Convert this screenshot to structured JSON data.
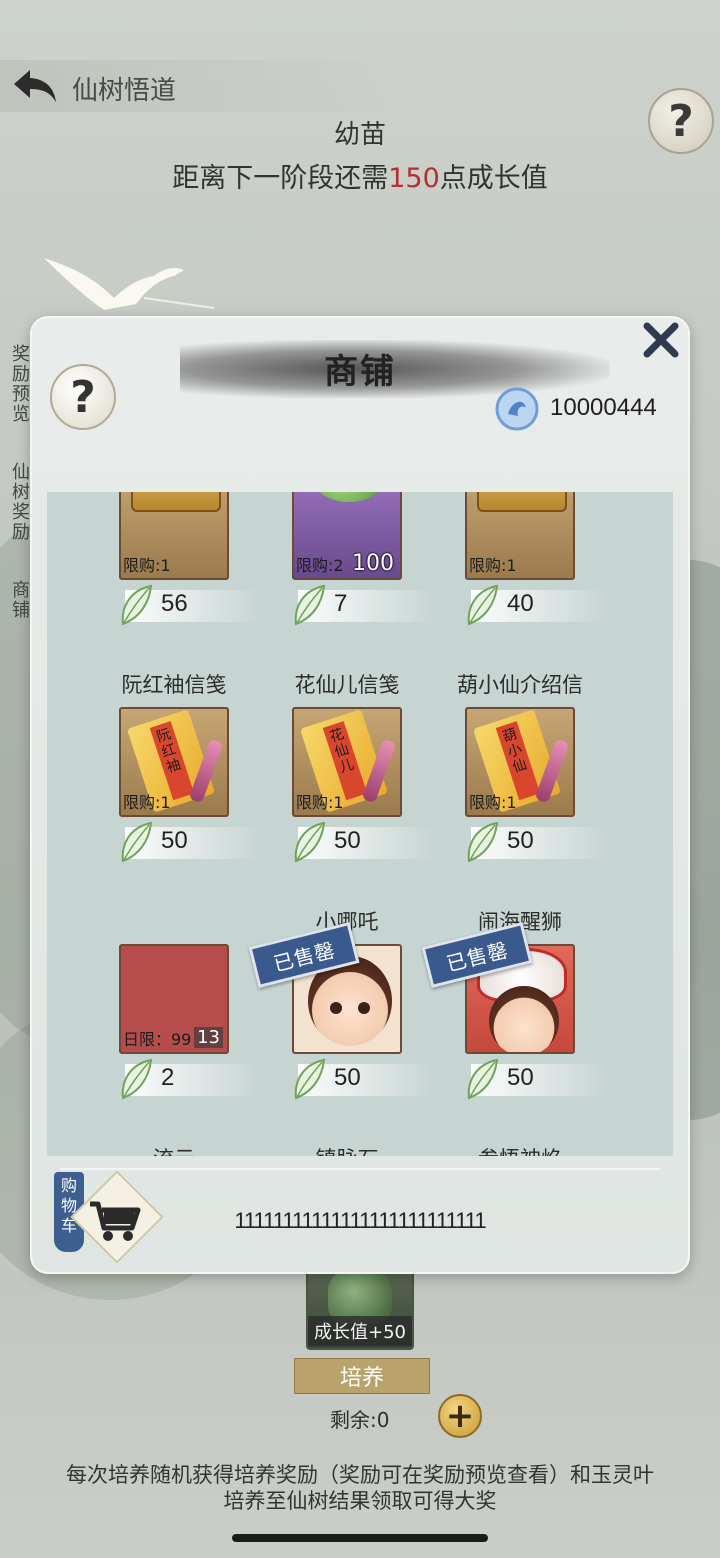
{
  "header": {
    "title": "仙树悟道",
    "stage_name": "幼苗",
    "stage_need_prefix": "距离下一阶段还需",
    "stage_need_value": "150",
    "stage_need_suffix": "点成长值"
  },
  "side_tabs": [
    "奖励预览",
    "仙树奖励",
    "商铺"
  ],
  "shop": {
    "title": "商铺",
    "currency_amount": "10000444",
    "items": [
      {
        "name": "",
        "limit": "限购:1",
        "qty": "",
        "price": "56",
        "art": "chest",
        "sold_out": false
      },
      {
        "name": "",
        "limit": "限购:2",
        "qty": "100",
        "price": "7",
        "art": "jade",
        "sold_out": false
      },
      {
        "name": "",
        "limit": "限购:1",
        "qty": "",
        "price": "40",
        "art": "chest",
        "sold_out": false
      },
      {
        "name": "阮红袖信笺",
        "limit": "限购:1",
        "qty": "",
        "price": "50",
        "art": "letter",
        "letter_text": "阮红袖",
        "sold_out": false
      },
      {
        "name": "花仙儿信笺",
        "limit": "限购:1",
        "qty": "",
        "price": "50",
        "art": "letter",
        "letter_text": "花仙儿",
        "sold_out": false
      },
      {
        "name": "葫小仙介绍信",
        "limit": "限购:1",
        "qty": "",
        "price": "50",
        "art": "letter",
        "letter_text": "葫小仙",
        "sold_out": false
      },
      {
        "name": "",
        "limit": "日限：99",
        "qty": "13",
        "price": "2",
        "art": "red",
        "sold_out": false
      },
      {
        "name": "小哪吒",
        "limit": "",
        "qty": "",
        "price": "50",
        "art": "nezha",
        "sold_out": true
      },
      {
        "name": "闹海醒狮",
        "limit": "",
        "qty": "",
        "price": "50",
        "art": "lion",
        "sold_out": true
      },
      {
        "name": "流云",
        "limit": "",
        "qty": "",
        "price": "",
        "art": "red",
        "sold_out": true
      },
      {
        "name": "镇脉石",
        "limit": "",
        "qty": "",
        "price": "",
        "art": "red",
        "sold_out": true
      },
      {
        "name": "参悟神焰",
        "limit": "",
        "qty": "",
        "price": "",
        "art": "red",
        "sold_out": true
      }
    ],
    "sold_out_label": "已售罄",
    "cart_label": "购物车",
    "cart_content": "11111111111111111111111111"
  },
  "bottom": {
    "growth_label": "成长值+50",
    "cultivate_label": "培养",
    "remaining": "剩余:0",
    "tip_line1": "每次培养随机获得培养奖励（奖励可在奖励预览查看）和玉灵叶",
    "tip_line2": "培养至仙树结果领取可得大奖"
  },
  "colors": {
    "accent_red": "#b33030",
    "sold_stamp": "#3a5a8e",
    "item_red": "#b64c4c"
  },
  "icons": [
    "back-arrow-icon",
    "help-icon",
    "close-icon",
    "currency-orb-icon",
    "leaf-icon",
    "cart-icon",
    "plus-icon",
    "crane-icon"
  ]
}
